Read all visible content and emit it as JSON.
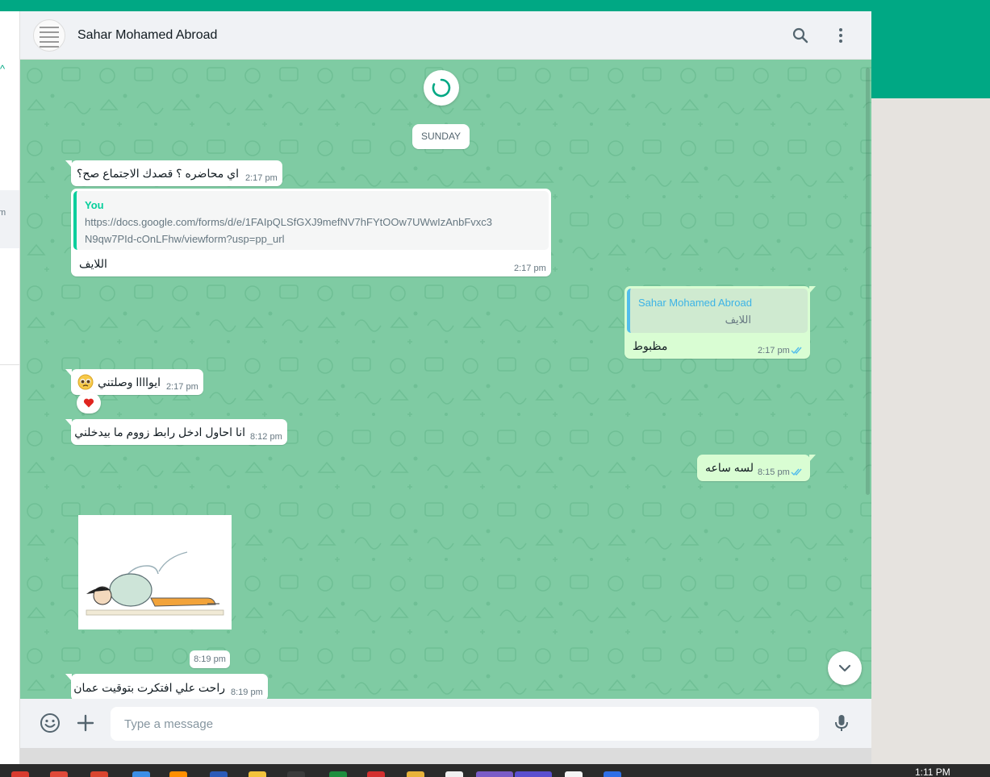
{
  "chat": {
    "contact_name": "Sahar Mohamed Abroad",
    "header_icons": [
      "search-icon",
      "menu-dots-icon"
    ],
    "date_divider": "SUNDAY",
    "messages": [
      {
        "direction": "in",
        "text": "اي محاضره ؟ قصدك الاجتماع صح؟",
        "time": "2:17 pm"
      },
      {
        "direction": "in",
        "quote": {
          "author": "You",
          "line1": "https://docs.google.com/forms/d/e/1FAIpQLSfGXJ9mefNV7hFYtOOw7UWwIzAnbFvxc3",
          "line2": "N9qw7PId-cOnLFhw/viewform?usp=pp_url"
        },
        "text": "اللايف",
        "time": "2:17 pm"
      },
      {
        "direction": "out",
        "quote": {
          "author": "Sahar Mohamed Abroad",
          "text": "اللايف"
        },
        "text": "مظبوط",
        "time": "2:17 pm",
        "status": "read"
      },
      {
        "direction": "in",
        "text": "ايواااا وصلتني",
        "emoji": "pleading-face",
        "time": "2:17 pm",
        "reaction": "red-heart"
      },
      {
        "direction": "in",
        "text": "انا احاول ادخل رابط زووم ما بيدخلني",
        "time": "8:12 pm"
      },
      {
        "direction": "out",
        "text": "لسه ساعه",
        "time": "8:15 pm",
        "status": "read"
      },
      {
        "direction": "in",
        "type": "sticker",
        "time": "8:19 pm"
      },
      {
        "direction": "in",
        "text": "راحت علي افتكرت بتوقيت عمان",
        "time": "8:19 pm"
      }
    ]
  },
  "composer": {
    "placeholder": "Type a message",
    "icons": [
      "emoji-icon",
      "attach-plus-icon",
      "microphone-icon"
    ]
  },
  "sidebar": {
    "partial_text": "m"
  },
  "taskbar": {
    "clock": "1:11 PM"
  },
  "colors": {
    "brand": "#00a884",
    "wallpaper": "#7fcba3",
    "outgoing_bubble": "#d9fdd3",
    "incoming_bubble": "#ffffff",
    "read_ticks": "#53bdeb"
  }
}
